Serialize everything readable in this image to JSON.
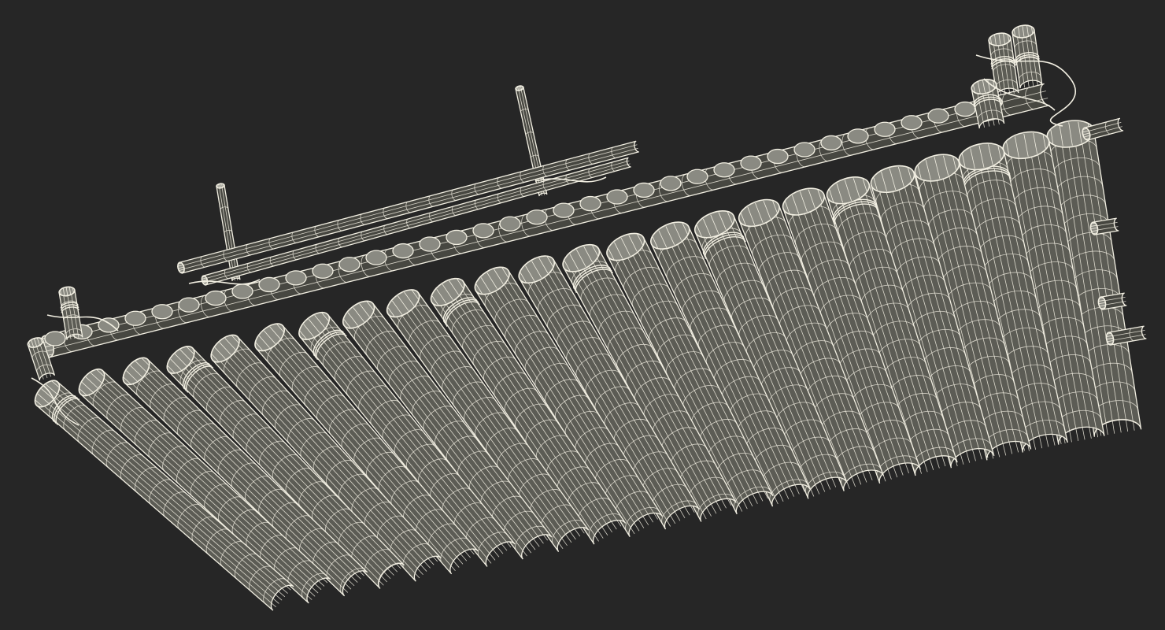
{
  "scene": {
    "subject": "bamboo-raft-wireframe",
    "colors": {
      "background": "#262626",
      "wire": "#f2efe2",
      "shade": "#5c5c55",
      "shade_dark": "#474741",
      "end_cap": "#8a8a82"
    }
  }
}
